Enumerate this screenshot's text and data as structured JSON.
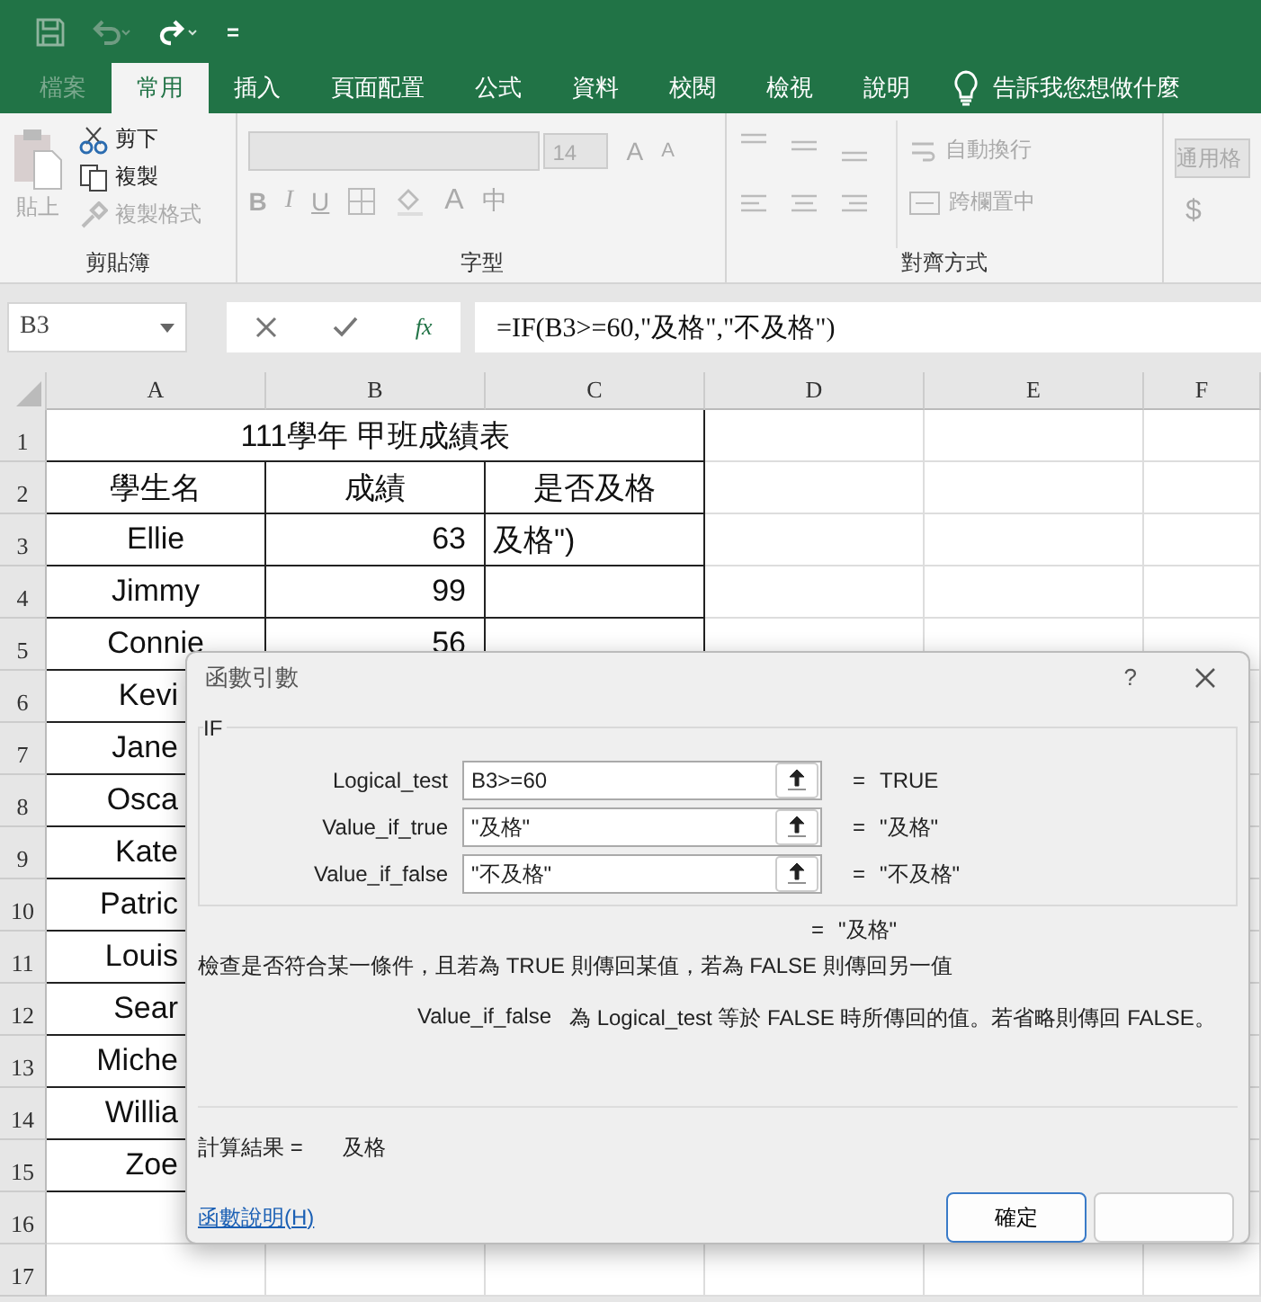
{
  "title_bar": {
    "customize": "="
  },
  "tabs": [
    {
      "label": "檔案",
      "selected": false,
      "disabled": true
    },
    {
      "label": "常用",
      "selected": true,
      "disabled": false
    },
    {
      "label": "插入",
      "selected": false,
      "disabled": false
    },
    {
      "label": "頁面配置",
      "selected": false,
      "disabled": false
    },
    {
      "label": "公式",
      "selected": false,
      "disabled": false
    },
    {
      "label": "資料",
      "selected": false,
      "disabled": false
    },
    {
      "label": "校閱",
      "selected": false,
      "disabled": false
    },
    {
      "label": "檢視",
      "selected": false,
      "disabled": false
    },
    {
      "label": "說明",
      "selected": false,
      "disabled": false
    }
  ],
  "tell_me": "告訴我您想做什麼",
  "ribbon": {
    "clipboard": {
      "label": "剪貼簿",
      "paste": {
        "label": "貼上",
        "disabled": true
      },
      "commands": [
        {
          "label": "剪下",
          "kind": "cut",
          "disabled": false
        },
        {
          "label": "複製",
          "kind": "copy",
          "disabled": false
        },
        {
          "label": "複製格式",
          "kind": "brush",
          "disabled": true
        }
      ]
    },
    "font": {
      "label": "字型",
      "size": "14",
      "size_buttons": [
        "A",
        "A"
      ],
      "format_buttons": [
        "B",
        "I",
        "U"
      ],
      "font_color": "A",
      "phonetic": "中"
    },
    "alignment": {
      "label": "對齊方式",
      "commands": [
        {
          "label": "自動換行",
          "kind": "wrap",
          "disabled": true
        },
        {
          "label": "跨欄置中",
          "kind": "merge",
          "disabled": true
        }
      ]
    },
    "number": {
      "format": "通用格",
      "currency": "$"
    }
  },
  "formula_bar": {
    "name_box": "B3",
    "fx": "fx",
    "formula": "=IF(B3>=60,\"及格\",\"不及格\")"
  },
  "columns": [
    "A",
    "B",
    "C",
    "D",
    "E",
    "F"
  ],
  "rows": [
    {
      "number": "1",
      "kind": "title",
      "cells": [
        "111學年 甲班成績表"
      ]
    },
    {
      "number": "2",
      "kind": "header",
      "cells": [
        "學生名",
        "成績",
        "是否及格"
      ]
    },
    {
      "number": "3",
      "kind": "data",
      "cells": [
        "Ellie",
        "63",
        "及格\")"
      ]
    },
    {
      "number": "4",
      "kind": "data",
      "cells": [
        "Jimmy",
        "99"
      ]
    },
    {
      "number": "5",
      "kind": "data",
      "cells": [
        "Connie",
        "56"
      ]
    },
    {
      "number": "6",
      "kind": "cut",
      "cells": [
        "Kevi"
      ]
    },
    {
      "number": "7",
      "kind": "cut",
      "cells": [
        "Jane"
      ]
    },
    {
      "number": "8",
      "kind": "cut",
      "cells": [
        "Osca"
      ]
    },
    {
      "number": "9",
      "kind": "cut",
      "cells": [
        "Kate"
      ]
    },
    {
      "number": "10",
      "kind": "cut",
      "cells": [
        "Patric"
      ]
    },
    {
      "number": "11",
      "kind": "cut",
      "cells": [
        "Louis"
      ]
    },
    {
      "number": "12",
      "kind": "cut",
      "cells": [
        "Sear"
      ]
    },
    {
      "number": "13",
      "kind": "cut",
      "cells": [
        "Miche"
      ]
    },
    {
      "number": "14",
      "kind": "cut",
      "cells": [
        "Willia"
      ]
    },
    {
      "number": "15",
      "kind": "cut",
      "cells": [
        "Zoe"
      ]
    },
    {
      "number": "16",
      "kind": "empty"
    },
    {
      "number": "17",
      "kind": "empty"
    }
  ],
  "dialog": {
    "title": "函數引數",
    "help": "?",
    "function": "IF",
    "args": [
      {
        "name": "Logical_test",
        "value": "B3>=60",
        "eq": "=",
        "result": "TRUE"
      },
      {
        "name": "Value_if_true",
        "value": "\"及格\"",
        "eq": "=",
        "result": "\"及格\""
      },
      {
        "name": "Value_if_false",
        "value": "\"不及格\"",
        "eq": "=",
        "result": "\"不及格\""
      }
    ],
    "eq": "=",
    "result": "\"及格\"",
    "description": "檢查是否符合某一條件，且若為 TRUE 則傳回某值，若為 FALSE 則傳回另一值",
    "arg_name": "Value_if_false",
    "arg_description": "為 Logical_test 等於 FALSE 時所傳回的值。若省略則傳回 FALSE。",
    "formula_result_label": "計算結果 =",
    "formula_result": "及格",
    "help_link": "函數說明(H)",
    "ok": "確定"
  }
}
